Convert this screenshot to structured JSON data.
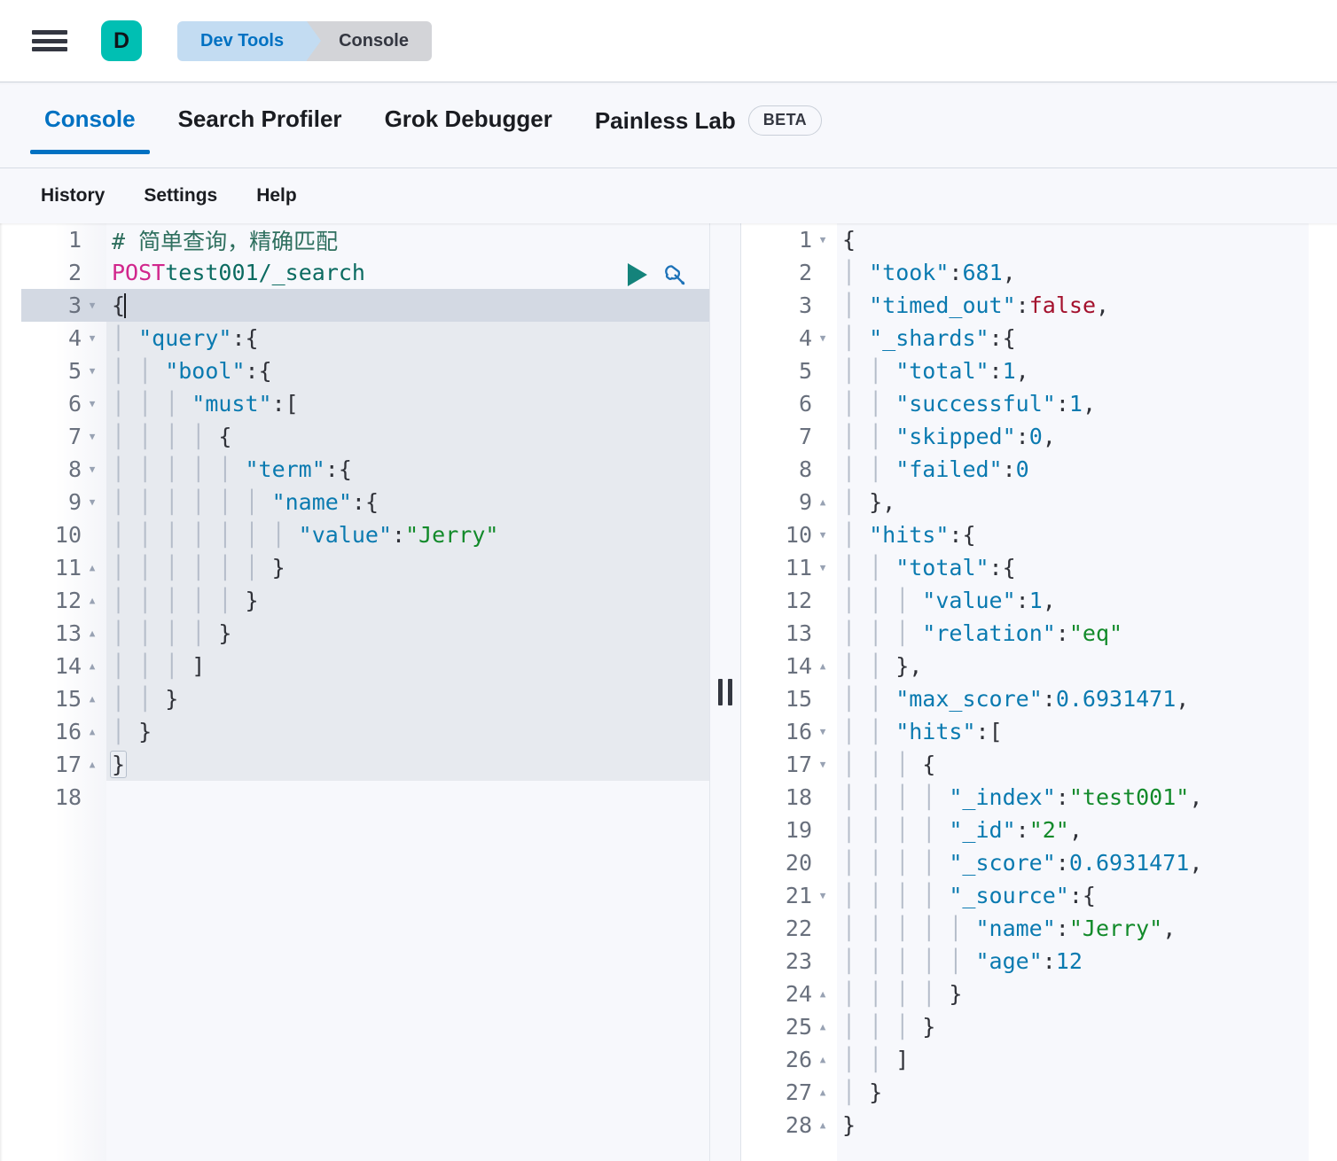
{
  "header": {
    "menu_icon": "hamburger-icon",
    "logo_letter": "D",
    "logo_color": "#00bfb3",
    "breadcrumbs": [
      {
        "label": "Dev Tools",
        "color": "#0071c2",
        "bg": "#c3dcf2"
      },
      {
        "label": "Console",
        "color": "#343741",
        "bg": "#d3d4d8"
      }
    ]
  },
  "tabs": [
    {
      "label": "Console",
      "active": true
    },
    {
      "label": "Search Profiler",
      "active": false
    },
    {
      "label": "Grok Debugger",
      "active": false
    },
    {
      "label": "Painless Lab",
      "active": false,
      "badge": "BETA"
    }
  ],
  "sub_toolbar": [
    {
      "label": "History"
    },
    {
      "label": "Settings"
    },
    {
      "label": "Help"
    }
  ],
  "accent_color": "#0071c2",
  "editor": {
    "active_line": 3,
    "total_lines": 18,
    "run_button": "play-icon",
    "wrench_button": "wrench-icon",
    "lines": [
      {
        "n": 1,
        "fold": "",
        "text": "# 简单查询，精确匹配"
      },
      {
        "n": 2,
        "fold": "",
        "text": "POST test001/_search"
      },
      {
        "n": 3,
        "fold": "down",
        "text": "{"
      },
      {
        "n": 4,
        "fold": "down",
        "text": "  \"query\": {"
      },
      {
        "n": 5,
        "fold": "down",
        "text": "    \"bool\": {"
      },
      {
        "n": 6,
        "fold": "down",
        "text": "      \"must\": ["
      },
      {
        "n": 7,
        "fold": "down",
        "text": "        {"
      },
      {
        "n": 8,
        "fold": "down",
        "text": "          \"term\": {"
      },
      {
        "n": 9,
        "fold": "down",
        "text": "            \"name\": {"
      },
      {
        "n": 10,
        "fold": "",
        "text": "              \"value\": \"Jerry\""
      },
      {
        "n": 11,
        "fold": "up",
        "text": "            }"
      },
      {
        "n": 12,
        "fold": "up",
        "text": "          }"
      },
      {
        "n": 13,
        "fold": "up",
        "text": "        }"
      },
      {
        "n": 14,
        "fold": "up",
        "text": "      ]"
      },
      {
        "n": 15,
        "fold": "up",
        "text": "    }"
      },
      {
        "n": 16,
        "fold": "up",
        "text": "  }"
      },
      {
        "n": 17,
        "fold": "up",
        "text": "}"
      },
      {
        "n": 18,
        "fold": "",
        "text": ""
      }
    ],
    "request_method": "POST",
    "request_path": "test001/_search",
    "comment_text": "# 简单查询，精确匹配",
    "body": {
      "query": {
        "bool": {
          "must": [
            {
              "term": {
                "name": {
                  "value": "Jerry"
                }
              }
            }
          ]
        }
      }
    }
  },
  "response": {
    "total_lines": 28,
    "lines": [
      {
        "n": 1,
        "fold": "down",
        "text": "{"
      },
      {
        "n": 2,
        "fold": "",
        "text": "  \"took\" : 681,"
      },
      {
        "n": 3,
        "fold": "",
        "text": "  \"timed_out\" : false,"
      },
      {
        "n": 4,
        "fold": "down",
        "text": "  \"_shards\" : {"
      },
      {
        "n": 5,
        "fold": "",
        "text": "    \"total\" : 1,"
      },
      {
        "n": 6,
        "fold": "",
        "text": "    \"successful\" : 1,"
      },
      {
        "n": 7,
        "fold": "",
        "text": "    \"skipped\" : 0,"
      },
      {
        "n": 8,
        "fold": "",
        "text": "    \"failed\" : 0"
      },
      {
        "n": 9,
        "fold": "up",
        "text": "  },"
      },
      {
        "n": 10,
        "fold": "down",
        "text": "  \"hits\" : {"
      },
      {
        "n": 11,
        "fold": "down",
        "text": "    \"total\" : {"
      },
      {
        "n": 12,
        "fold": "",
        "text": "      \"value\" : 1,"
      },
      {
        "n": 13,
        "fold": "",
        "text": "      \"relation\" : \"eq\""
      },
      {
        "n": 14,
        "fold": "up",
        "text": "    },"
      },
      {
        "n": 15,
        "fold": "",
        "text": "    \"max_score\" : 0.6931471,"
      },
      {
        "n": 16,
        "fold": "down",
        "text": "    \"hits\" : ["
      },
      {
        "n": 17,
        "fold": "down",
        "text": "      {"
      },
      {
        "n": 18,
        "fold": "",
        "text": "        \"_index\" : \"test001\","
      },
      {
        "n": 19,
        "fold": "",
        "text": "        \"_id\" : \"2\","
      },
      {
        "n": 20,
        "fold": "",
        "text": "        \"_score\" : 0.6931471,"
      },
      {
        "n": 21,
        "fold": "down",
        "text": "        \"_source\" : {"
      },
      {
        "n": 22,
        "fold": "",
        "text": "          \"name\" : \"Jerry\","
      },
      {
        "n": 23,
        "fold": "",
        "text": "          \"age\" : 12"
      },
      {
        "n": 24,
        "fold": "up",
        "text": "        }"
      },
      {
        "n": 25,
        "fold": "up",
        "text": "      }"
      },
      {
        "n": 26,
        "fold": "up",
        "text": "    ]"
      },
      {
        "n": 27,
        "fold": "up",
        "text": "  }"
      },
      {
        "n": 28,
        "fold": "up",
        "text": "}"
      }
    ],
    "values": {
      "took": 681,
      "timed_out": false,
      "_shards": {
        "total": 1,
        "successful": 1,
        "skipped": 0,
        "failed": 0
      },
      "hits": {
        "total": {
          "value": 1,
          "relation": "eq"
        },
        "max_score": 0.6931471,
        "hits": [
          {
            "_index": "test001",
            "_id": "2",
            "_score": 0.6931471,
            "_source": {
              "name": "Jerry",
              "age": 12
            }
          }
        ]
      }
    }
  },
  "resizer": {
    "label": "panel-resize-handle"
  }
}
